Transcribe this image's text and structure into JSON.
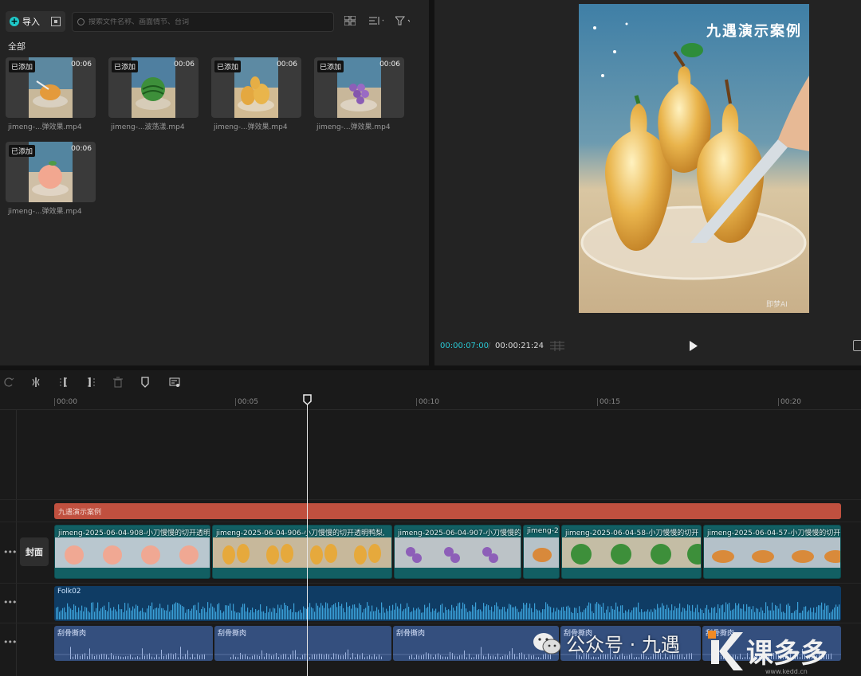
{
  "media": {
    "import_label": "导入",
    "search_placeholder": "搜索文件名称、画面情节、台词",
    "category": "全部",
    "items": [
      {
        "badge": "已添加",
        "duration": "00:06",
        "name": "jimeng-...弹效果.mp4"
      },
      {
        "badge": "已添加",
        "duration": "00:06",
        "name": "jimeng-...波荡漾.mp4"
      },
      {
        "badge": "已添加",
        "duration": "00:06",
        "name": "jimeng-...弹效果.mp4"
      },
      {
        "badge": "已添加",
        "duration": "00:06",
        "name": "jimeng-...弹效果.mp4"
      },
      {
        "badge": "已添加",
        "duration": "00:06",
        "name": "jimeng-...弹效果.mp4"
      }
    ]
  },
  "preview": {
    "overlay_title": "九遇演示案例",
    "current_time": "00:00:07:00",
    "separator": "/",
    "total_time": "00:00:21:24",
    "watermark": "即梦AI"
  },
  "timeline": {
    "ruler": [
      "00:00",
      "00:05",
      "00:10",
      "00:15",
      "00:20"
    ],
    "playhead_seconds": 7.0,
    "title_clip": "九遇演示案例",
    "cover_label": "封面",
    "video_clips": [
      "jimeng-2025-06-04-908-小刀慢慢的切开透明",
      "jimeng-2025-06-04-906-小刀慢慢的切开透明鸭梨,",
      "jimeng-2025-06-04-907-小刀慢慢的",
      "jimeng-2",
      "jimeng-2025-06-04-58-小刀慢慢的切开",
      "jimeng-2025-06-04-57-小刀慢慢的切开"
    ],
    "audio_clip": "Folk02",
    "sfx_clips": [
      "刮骨撕肉",
      "刮骨撕肉",
      "刮骨撕肉",
      "刮骨撕肉",
      "刮骨撕肉"
    ]
  },
  "watermarks": {
    "wechat_text": "公众号 · 九遇",
    "site_logo": "课多多",
    "site_url": "www.kedd.cn"
  },
  "colors": {
    "accent": "#29c7d3",
    "title_clip": "#c0503f",
    "video_clip": "#125f63",
    "audio_clip": "#0f3c64",
    "sfx_clip": "#344f7e"
  }
}
